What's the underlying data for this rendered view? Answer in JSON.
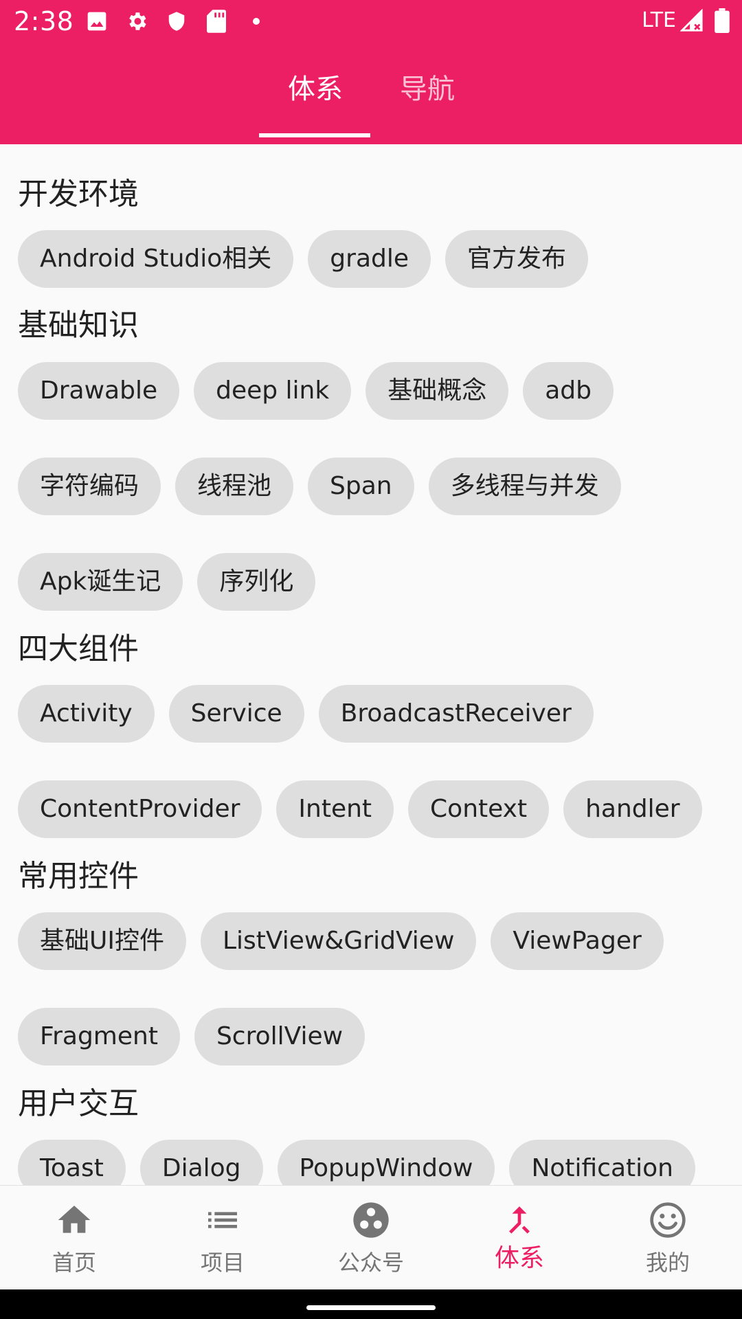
{
  "status": {
    "time": "2:38",
    "network": "LTE"
  },
  "tabs": [
    {
      "label": "体系",
      "active": true
    },
    {
      "label": "导航",
      "active": false
    }
  ],
  "sections": [
    {
      "title": "开发环境",
      "rows": [
        [
          "Android Studio相关",
          "gradle",
          "官方发布"
        ]
      ]
    },
    {
      "title": "基础知识",
      "rows": [
        [
          "Drawable",
          "deep link",
          "基础概念",
          "adb"
        ],
        [
          "字符编码",
          "线程池",
          "Span",
          "多线程与并发"
        ],
        [
          "Apk诞生记",
          "序列化"
        ]
      ]
    },
    {
      "title": "四大组件",
      "rows": [
        [
          "Activity",
          "Service",
          "BroadcastReceiver"
        ],
        [
          "ContentProvider",
          "Intent",
          "Context",
          "handler"
        ]
      ]
    },
    {
      "title": "常用控件",
      "rows": [
        [
          "基础UI控件",
          "ListView&GridView",
          "ViewPager"
        ],
        [
          "Fragment",
          "ScrollView"
        ]
      ]
    },
    {
      "title": "用户交互",
      "rows": [
        [
          "Toast",
          "Dialog",
          "PopupWindow",
          "Notification"
        ]
      ]
    }
  ],
  "bottom_nav": [
    {
      "label": "首页",
      "icon": "home-icon"
    },
    {
      "label": "项目",
      "icon": "list-icon"
    },
    {
      "label": "公众号",
      "icon": "dots-circle-icon"
    },
    {
      "label": "体系",
      "icon": "merge-arrow-icon",
      "active": true
    },
    {
      "label": "我的",
      "icon": "smiley-icon"
    }
  ],
  "colors": {
    "primary": "#ec1f64",
    "chip_bg": "#dedede",
    "nav_inactive": "#757575"
  }
}
